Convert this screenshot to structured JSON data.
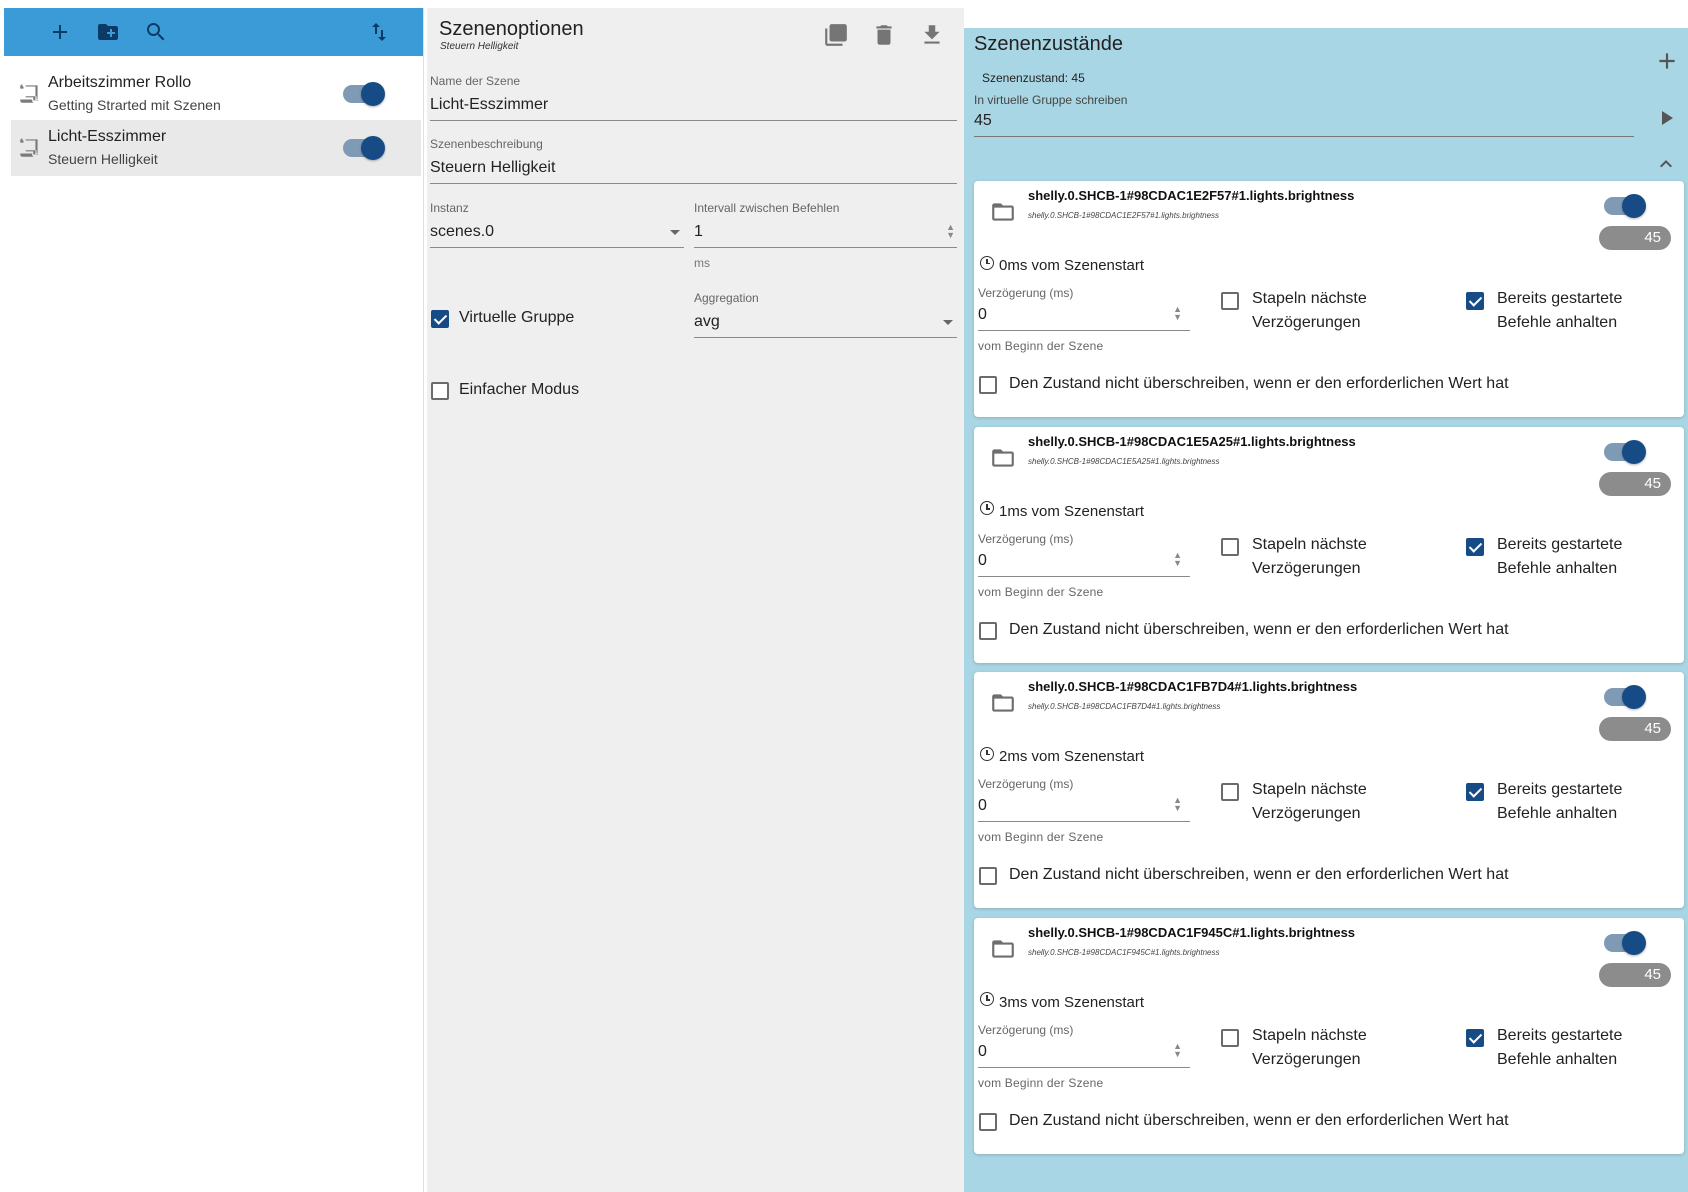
{
  "toolbar": {
    "icons": [
      "add-icon",
      "create-folder-icon",
      "search-icon",
      "sort-icon"
    ]
  },
  "scenes": [
    {
      "title": "Arbeitszimmer Rollo",
      "subtitle": "Getting Strarted mit Szenen",
      "enabled": true,
      "selected": false
    },
    {
      "title": "Licht-Esszimmer",
      "subtitle": "Steuern Helligkeit",
      "enabled": true,
      "selected": true
    }
  ],
  "options": {
    "title": "Szenenoptionen",
    "subtitle": "Steuern Helligkeit",
    "name_label": "Name der Szene",
    "name_value": "Licht-Esszimmer",
    "desc_label": "Szenenbeschreibung",
    "desc_value": "Steuern Helligkeit",
    "instance_label": "Instanz",
    "instance_value": "scenes.0",
    "interval_label": "Intervall zwischen Befehlen",
    "interval_value": "1",
    "interval_unit": "ms",
    "virtual_group_label": "Virtuelle Gruppe",
    "virtual_group_checked": true,
    "aggregation_label": "Aggregation",
    "aggregation_value": "avg",
    "simple_mode_label": "Einfacher Modus",
    "simple_mode_checked": false
  },
  "states": {
    "title": "Szenenzustände",
    "state_text": "Szenenzustand: 45",
    "vg_label": "In virtuelle Gruppe schreiben",
    "vg_value": "45",
    "cards": [
      {
        "name": "shelly.0.SHCB-1#98CDAC1E2F57#1.lights.brightness",
        "id": "shelly.0.SHCB-1#98CDAC1E2F57#1.lights.brightness",
        "value": "45",
        "delay_head": "0ms vom Szenenstart",
        "delay_label": "Verzögerung (ms)",
        "delay_value": "0",
        "delay_helper": "vom Beginn der Szene",
        "stack_label": "Stapeln nächste Verzögerungen",
        "stack_checked": false,
        "stop_label": "Bereits gestartete Befehle anhalten",
        "stop_checked": true,
        "nooverwrite_label": "Den Zustand nicht überschreiben, wenn er den erforderlichen Wert hat",
        "nooverwrite_checked": false
      },
      {
        "name": "shelly.0.SHCB-1#98CDAC1E5A25#1.lights.brightness",
        "id": "shelly.0.SHCB-1#98CDAC1E5A25#1.lights.brightness",
        "value": "45",
        "delay_head": "1ms vom Szenenstart",
        "delay_label": "Verzögerung (ms)",
        "delay_value": "0",
        "delay_helper": "vom Beginn der Szene",
        "stack_label": "Stapeln nächste Verzögerungen",
        "stack_checked": false,
        "stop_label": "Bereits gestartete Befehle anhalten",
        "stop_checked": true,
        "nooverwrite_label": "Den Zustand nicht überschreiben, wenn er den erforderlichen Wert hat",
        "nooverwrite_checked": false
      },
      {
        "name": "shelly.0.SHCB-1#98CDAC1FB7D4#1.lights.brightness",
        "id": "shelly.0.SHCB-1#98CDAC1FB7D4#1.lights.brightness",
        "value": "45",
        "delay_head": "2ms vom Szenenstart",
        "delay_label": "Verzögerung (ms)",
        "delay_value": "0",
        "delay_helper": "vom Beginn der Szene",
        "stack_label": "Stapeln nächste Verzögerungen",
        "stack_checked": false,
        "stop_label": "Bereits gestartete Befehle anhalten",
        "stop_checked": true,
        "nooverwrite_label": "Den Zustand nicht überschreiben, wenn er den erforderlichen Wert hat",
        "nooverwrite_checked": false
      },
      {
        "name": "shelly.0.SHCB-1#98CDAC1F945C#1.lights.brightness",
        "id": "shelly.0.SHCB-1#98CDAC1F945C#1.lights.brightness",
        "value": "45",
        "delay_head": "3ms vom Szenenstart",
        "delay_label": "Verzögerung (ms)",
        "delay_value": "0",
        "delay_helper": "vom Beginn der Szene",
        "stack_label": "Stapeln nächste Verzögerungen",
        "stack_checked": false,
        "stop_label": "Bereits gestartete Befehle anhalten",
        "stop_checked": true,
        "nooverwrite_label": "Den Zustand nicht überschreiben, wenn er den erforderlichen Wert hat",
        "nooverwrite_checked": false
      }
    ]
  },
  "colors": {
    "toolbar": "#3b9bd7",
    "accent": "#164b85",
    "states_bg": "#a9d6e4",
    "options_bg": "#efefef"
  }
}
